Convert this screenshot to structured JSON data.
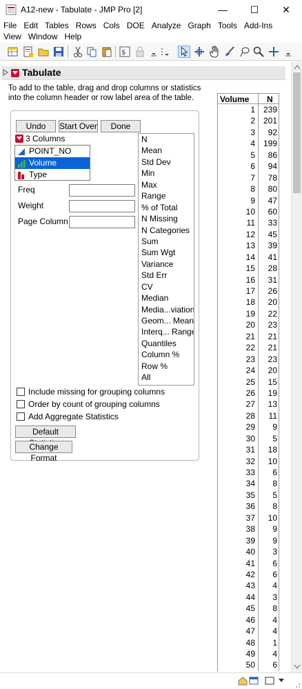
{
  "window": {
    "title": "A12-new - Tabulate - JMP Pro [2]",
    "minimize": "—",
    "maximize": "☐",
    "close": "✕"
  },
  "menu": {
    "row1": [
      "File",
      "Edit",
      "Tables",
      "Rows",
      "Cols",
      "DOE",
      "Analyze",
      "Graph",
      "Tools",
      "Add-Ins"
    ],
    "row2": [
      "View",
      "Window",
      "Help"
    ]
  },
  "report": {
    "title": "Tabulate",
    "instructions_line1": "To add to the table, drag and drop columns or statistics",
    "instructions_line2": "into the column header or row label area of the table."
  },
  "controls": {
    "undo": "Undo",
    "start_over": "Start Over",
    "done": "Done",
    "columns_header": "3 Columns",
    "columns": [
      "POINT_NO",
      "Volume",
      "Type"
    ],
    "selected_column": "Volume",
    "freq_label": "Freq",
    "weight_label": "Weight",
    "page_column_label": "Page Column",
    "statistics": [
      "N",
      "Mean",
      "Std Dev",
      "Min",
      "Max",
      "Range",
      "% of Total",
      "N Missing",
      "N Categories",
      "Sum",
      "Sum Wgt",
      "Variance",
      "Std Err",
      "CV",
      "Median",
      "Media...viation",
      "Geom... Mean",
      "Interq... Range",
      "Quantiles",
      "Column %",
      "Row %",
      "All"
    ],
    "include_missing": "Include missing for grouping columns",
    "order_by_count": "Order by count of grouping columns",
    "add_aggregate": "Add Aggregate Statistics",
    "default_statistics": "Default Statistics",
    "change_format": "Change Format"
  },
  "table": {
    "header_volume": "Volume",
    "header_n": "N",
    "rows": [
      [
        "1",
        "239"
      ],
      [
        "2",
        "201"
      ],
      [
        "3",
        "92"
      ],
      [
        "4",
        "199"
      ],
      [
        "5",
        "86"
      ],
      [
        "6",
        "94"
      ],
      [
        "7",
        "78"
      ],
      [
        "8",
        "80"
      ],
      [
        "9",
        "47"
      ],
      [
        "10",
        "60"
      ],
      [
        "11",
        "33"
      ],
      [
        "12",
        "45"
      ],
      [
        "13",
        "39"
      ],
      [
        "14",
        "41"
      ],
      [
        "15",
        "28"
      ],
      [
        "16",
        "31"
      ],
      [
        "17",
        "26"
      ],
      [
        "18",
        "20"
      ],
      [
        "19",
        "22"
      ],
      [
        "20",
        "23"
      ],
      [
        "21",
        "21"
      ],
      [
        "22",
        "21"
      ],
      [
        "23",
        "23"
      ],
      [
        "24",
        "20"
      ],
      [
        "25",
        "15"
      ],
      [
        "26",
        "19"
      ],
      [
        "27",
        "13"
      ],
      [
        "28",
        "11"
      ],
      [
        "29",
        "9"
      ],
      [
        "30",
        "5"
      ],
      [
        "31",
        "18"
      ],
      [
        "32",
        "10"
      ],
      [
        "33",
        "6"
      ],
      [
        "34",
        "8"
      ],
      [
        "35",
        "5"
      ],
      [
        "36",
        "8"
      ],
      [
        "37",
        "10"
      ],
      [
        "38",
        "9"
      ],
      [
        "39",
        "9"
      ],
      [
        "40",
        "3"
      ],
      [
        "41",
        "6"
      ],
      [
        "42",
        "6"
      ],
      [
        "43",
        "4"
      ],
      [
        "44",
        "3"
      ],
      [
        "45",
        "8"
      ],
      [
        "46",
        "4"
      ],
      [
        "47",
        "4"
      ],
      [
        "48",
        "1"
      ],
      [
        "49",
        "4"
      ],
      [
        "50",
        "6"
      ]
    ]
  },
  "colors": {
    "accent_red": "#c8102e",
    "selection_blue": "#0a64d8"
  }
}
